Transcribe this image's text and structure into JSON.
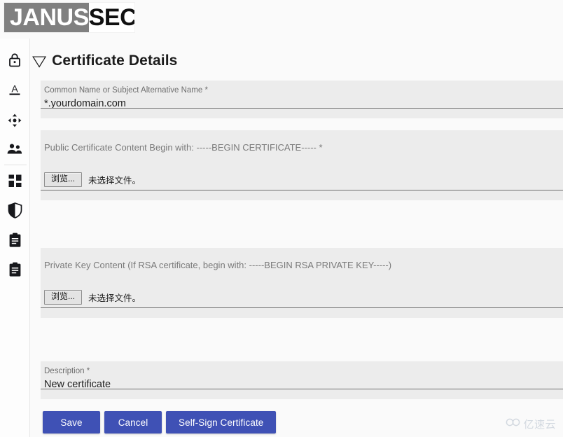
{
  "header": {
    "logo_left": "JANUS",
    "logo_right": "SEC"
  },
  "sidebar": {
    "items": [
      {
        "icon": "lock-icon",
        "name": "sidebar-item-certificates"
      },
      {
        "icon": "letter-a-underline-icon",
        "name": "sidebar-item-domains"
      },
      {
        "icon": "arrows-cross-icon",
        "name": "sidebar-item-routes"
      },
      {
        "icon": "people-icon",
        "name": "sidebar-item-users"
      },
      {
        "icon": "grid-dashboard-icon",
        "name": "sidebar-item-dashboard"
      },
      {
        "icon": "shield-icon",
        "name": "sidebar-item-security"
      },
      {
        "icon": "clipboard-icon",
        "name": "sidebar-item-logs"
      },
      {
        "icon": "clipboard-icon",
        "name": "sidebar-item-reports"
      }
    ]
  },
  "main": {
    "collapse_icon": "▽",
    "page_title": "Certificate Details",
    "fields": {
      "common_name": {
        "label": "Common Name or Subject Alternative Name *",
        "value": "*.yourdomain.com"
      },
      "public_certificate": {
        "label": "Public Certificate Content Begin with: -----BEGIN CERTIFICATE----- *",
        "browse_label": "浏览...",
        "file_status": "未选择文件。"
      },
      "private_key": {
        "label": "Private Key Content (If RSA certificate, begin with: -----BEGIN RSA PRIVATE KEY-----)",
        "browse_label": "浏览...",
        "file_status": "未选择文件。"
      },
      "description": {
        "label": "Description *",
        "value": "New certificate"
      }
    },
    "buttons": {
      "save": "Save",
      "cancel": "Cancel",
      "self_sign": "Self-Sign Certificate"
    }
  },
  "watermark": {
    "text": "亿速云"
  },
  "colors": {
    "accent": "#3f51b5",
    "logo_gray": "#808080",
    "field_bg": "#ececec",
    "page_bg": "#fafafa"
  }
}
